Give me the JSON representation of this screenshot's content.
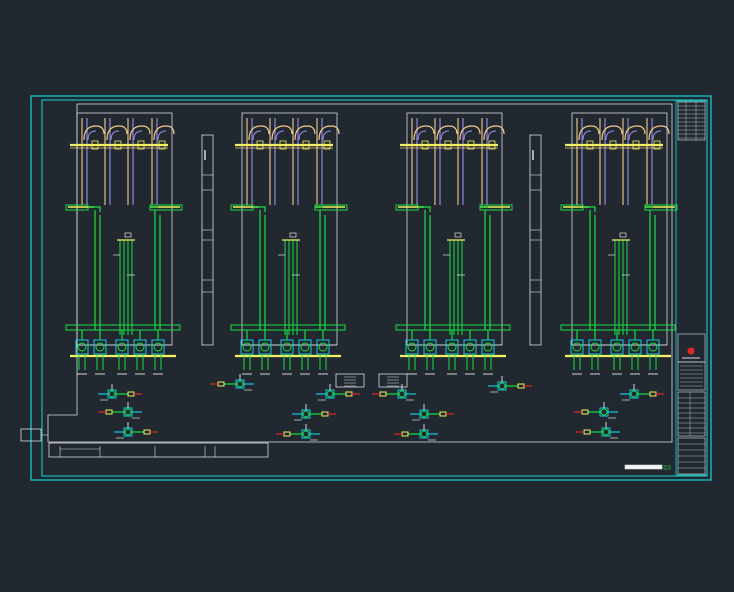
{
  "drawing": {
    "background": "#212830",
    "colors": {
      "frame": "#18d6d6",
      "structure": "#d8dce0",
      "process_pipe": "#f2c98a",
      "return_pipe": "#9a8ee8",
      "supply_pipe": "#18e040",
      "header": "#f0f060",
      "equipment": "#18c8e0",
      "valve": "#ffffff",
      "accent_red": "#e02828"
    },
    "title_block": {
      "logo_color": "#e02828"
    },
    "unit_count": 4
  }
}
